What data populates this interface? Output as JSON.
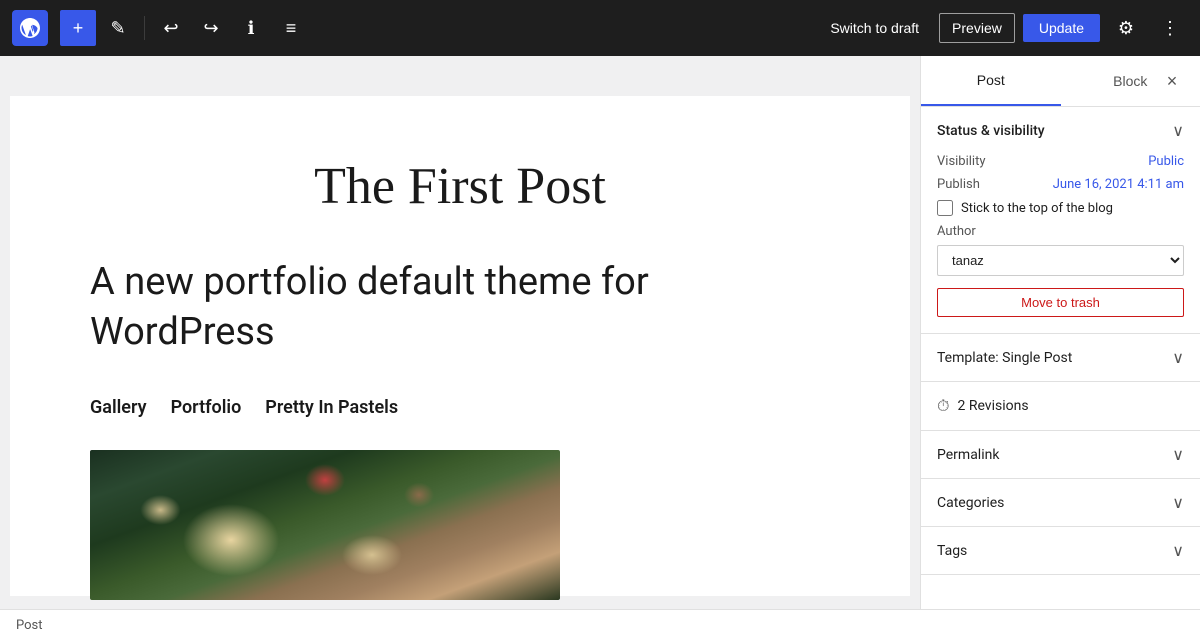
{
  "toolbar": {
    "add_label": "+",
    "tools_label": "✎",
    "undo_label": "↩",
    "redo_label": "↪",
    "info_label": "ℹ",
    "list_view_label": "≡",
    "switch_draft_label": "Switch to draft",
    "preview_label": "Preview",
    "update_label": "Update",
    "settings_label": "⚙",
    "more_label": "⋮"
  },
  "editor": {
    "post_title": "The First Post",
    "post_body_line1": "A new portfolio default theme for",
    "post_body_line2": "WordPress",
    "post_links": [
      "Gallery",
      "Portfolio",
      "Pretty In Pastels"
    ]
  },
  "status_bar": {
    "label": "Post"
  },
  "sidebar": {
    "tab_post": "Post",
    "tab_block": "Block",
    "close_label": "×",
    "status_visibility_label": "Status & visibility",
    "visibility_label": "Visibility",
    "visibility_value": "Public",
    "publish_label": "Publish",
    "publish_value": "June 16, 2021 4:11 am",
    "stick_to_top_label": "Stick to the top of the blog",
    "author_label": "Author",
    "author_value": "tanaz",
    "move_to_trash_label": "Move to trash",
    "template_label": "Template: Single Post",
    "revisions_label": "2 Revisions",
    "permalink_label": "Permalink",
    "categories_label": "Categories",
    "tags_label": "Tags",
    "collapse_icon": "∨",
    "chevron_down": "∨"
  }
}
